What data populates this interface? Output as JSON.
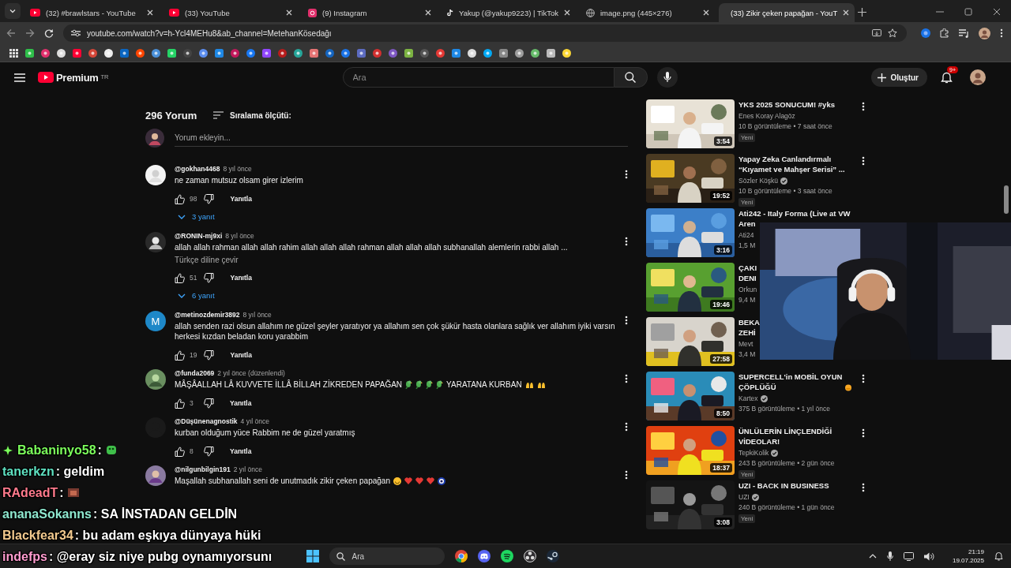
{
  "browser": {
    "tabs": [
      {
        "kind": "youtube",
        "title": "(32) #brawlstars - YouTube",
        "selected": false
      },
      {
        "kind": "youtube",
        "title": "(33) YouTube",
        "selected": false
      },
      {
        "kind": "instagram",
        "title": "(9) Instagram",
        "selected": false
      },
      {
        "kind": "tiktok",
        "title": "Yakup (@yakup9223) | TikTok",
        "selected": false
      },
      {
        "kind": "globe",
        "title": "image.png (445×276)",
        "selected": false
      },
      {
        "kind": "youtube",
        "title": "(33) Zikir çeken papağan - YouT",
        "selected": true
      }
    ],
    "url": "youtube.com/watch?v=h-Ycl4MEHu8&ab_channel=MetehanKösedağı"
  },
  "header": {
    "logo": "Premium",
    "region": "TR",
    "search_placeholder": "Ara",
    "create": "Oluştur",
    "notification_count": "9+"
  },
  "comments": {
    "count": "296 Yorum",
    "sort": "Sıralama ölçütü:",
    "add_placeholder": "Yorum ekleyin...",
    "items": [
      {
        "author": "@gokhan4468",
        "time": "8 yıl önce",
        "content": [
          {
            "kind": "text",
            "text": "ne zaman mutsuz olsam girer izlerim"
          }
        ],
        "likes": "98",
        "reply": "Yanıtla",
        "replies": "3 yanıt"
      },
      {
        "author": "@RONIN-mj9xi",
        "time": "8 yıl önce",
        "content": [
          {
            "kind": "text",
            "text": "allah allah rahman allah allah rahim allah allah allah rahman allah allah allah subhanallah alemlerin rabbi allah ..."
          }
        ],
        "translate": "Türkçe diline çevir",
        "likes": "51",
        "reply": "Yanıtla",
        "replies": "6 yanıt"
      },
      {
        "letter": "M",
        "author": "@metinozdemir3892",
        "time": "8 yıl önce",
        "content": [
          {
            "kind": "text",
            "text": "allah senden razi olsun allahım ne güzel şeyler yaratıyor ya allahım sen çok şükür hasta olanlara sağlık ver allahım iyiki varsın herkesi kızdan beladan koru yarabbim"
          }
        ],
        "likes": "19",
        "reply": "Yanıtla"
      },
      {
        "author": "@funda2069",
        "time": "2 yıl önce (düzenlendi)",
        "content": [
          {
            "kind": "text",
            "text": "MÂŞÂALLAH LÂ KUVVETE İLLÂ BİLLAH ZİKREDEN PAPAĞAN"
          },
          {
            "kind": "parrot"
          },
          {
            "kind": "parrot"
          },
          {
            "kind": "parrot"
          },
          {
            "kind": "parrot"
          },
          {
            "kind": "text",
            "text": "YARATANA KURBAN"
          },
          {
            "kind": "hands"
          },
          {
            "kind": "hands"
          }
        ],
        "likes": "3",
        "reply": "Yanıtla"
      },
      {
        "author": "@Düşünenagnostik",
        "time": "4 yıl önce",
        "content": [
          {
            "kind": "text",
            "text": "kurban olduğum yüce Rabbim ne de güzel yaratmış"
          }
        ],
        "likes": "8",
        "reply": "Yanıtla"
      },
      {
        "author": "@nilgunbilgin191",
        "time": "2 yıl önce",
        "content": [
          {
            "kind": "text",
            "text": "Maşallah subhanallah seni de unutmadık zikir çeken papağan"
          },
          {
            "kind": "smile"
          },
          {
            "kind": "heart"
          },
          {
            "kind": "heart"
          },
          {
            "kind": "heart"
          },
          {
            "kind": "nazar"
          }
        ]
      }
    ]
  },
  "related": [
    {
      "title": "YKS 2025 SONUCUM! #yks",
      "channel": "Enes Koray Alagöz",
      "verified": false,
      "meta": "10 B görüntüleme • 7 saat önce",
      "badge": "Yeni",
      "duration": "3:54",
      "covered": false
    },
    {
      "title": "Yapay Zeka Canlandırmalı “Kıyamet ve Mahşer Serisi” ...",
      "channel": "Sözler Köşkü",
      "verified": true,
      "meta": "10 B görüntüleme • 3 saat önce",
      "badge": "Yeni",
      "duration": "19:52",
      "covered": false
    },
    {
      "title": "Ati242 - Italy Forma (Live at VW\nAren",
      "channel": "Ati24",
      "verified": false,
      "meta": "1,5 M",
      "duration": "3:16",
      "covered": true
    },
    {
      "title": "ÇAKI\nDENI",
      "channel": "Orkun",
      "verified": false,
      "meta": "9,4 M",
      "duration": "19:46",
      "covered": true
    },
    {
      "title": "BEKA\nZEHİ",
      "channel": "Mevt",
      "verified": false,
      "meta": "3,4 M",
      "duration": "27:58",
      "covered": true
    },
    {
      "title": "SUPERCELL'in MOBİL OYUN ÇÖPLÜĞÜ",
      "title_emoji": true,
      "channel": "Kartex",
      "verified": true,
      "meta": "375 B görüntüleme • 1 yıl önce",
      "duration": "8:50",
      "covered": false
    },
    {
      "title": "ÜNLÜLERİN LİNÇLENDİĞİ VİDEOLAR!",
      "channel": "TepkiKolik",
      "verified": true,
      "meta": "243 B görüntüleme • 2 gün önce",
      "badge": "Yeni",
      "duration": "18:37",
      "covered": false
    },
    {
      "title": "UZI - BACK IN BUSINESS",
      "channel": "UZI",
      "verified": true,
      "meta": "240 B görüntüleme • 1 gün önce",
      "badge": "Yeni",
      "duration": "3:08",
      "covered": false
    }
  ],
  "chat": [
    {
      "name": "Babaninyo58",
      "color": "#7cff5c",
      "badge": true,
      "text": ":",
      "emote": true
    },
    {
      "name": "tanerkzn",
      "color": "#5ee0c0",
      "text": ": geldim"
    },
    {
      "name": "RAdeadT",
      "color": "#ff7a8c",
      "text": ":",
      "emote": true
    },
    {
      "name": "ananaSokanns",
      "color": "#8ee8cf",
      "text": ": SA İNSTADAN GELDİN"
    },
    {
      "name": "Blackfear34",
      "color": "#f2c98e",
      "text": ": bu adam eşkıya dünyaya hüki"
    },
    {
      "name": "indefps",
      "color": "#ff9ccf",
      "text": ": @eray siz niye pubg oynamıyorsunı"
    }
  ],
  "taskbar": {
    "search_placeholder": "Ara",
    "time": "21:19",
    "date": "19.07.2025"
  }
}
